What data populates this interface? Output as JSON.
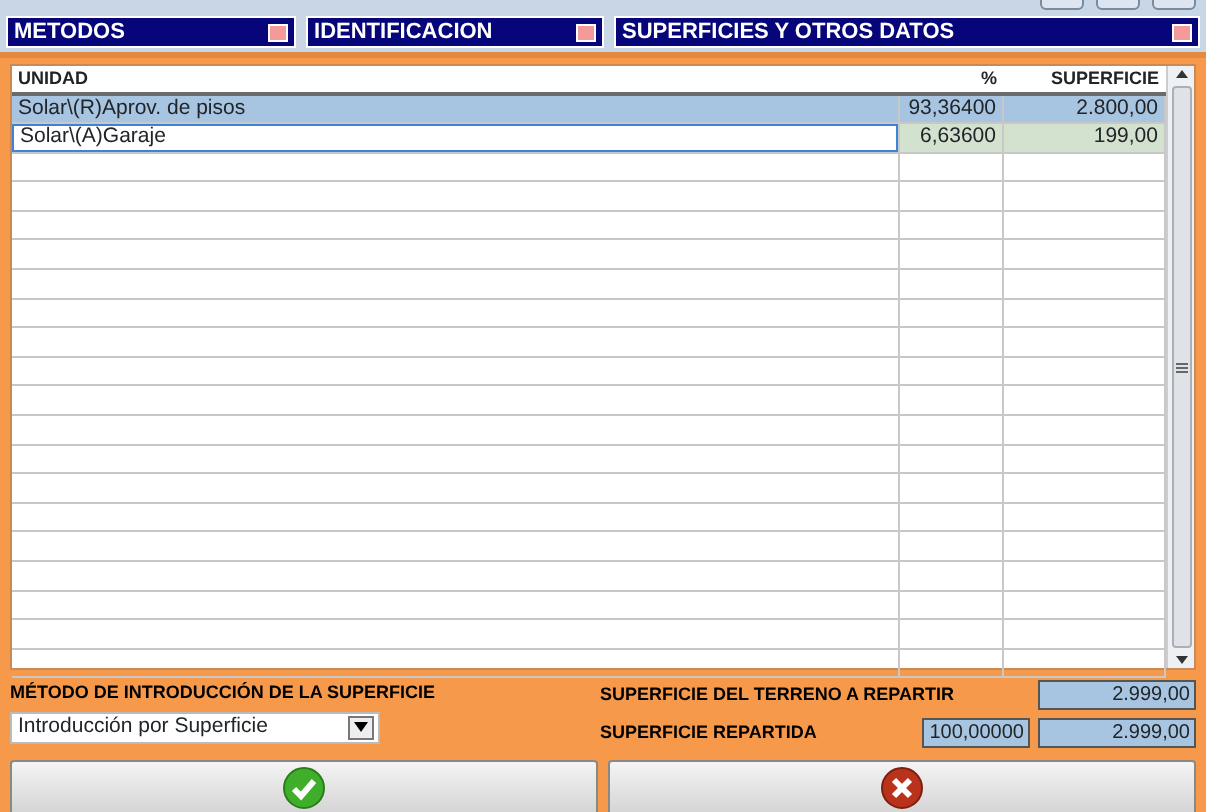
{
  "sections": [
    {
      "title": "METODOS"
    },
    {
      "title": "IDENTIFICACION"
    },
    {
      "title": "SUPERFICIES Y OTROS DATOS"
    }
  ],
  "table": {
    "columns": [
      "UNIDAD",
      "%",
      "SUPERFICIE"
    ],
    "rows": [
      {
        "cells": [
          "Solar\\(R)Aprov. de pisos",
          "93,36400",
          "2.800,00"
        ],
        "selected": true,
        "focused": false
      },
      {
        "cells": [
          "Solar\\(A)Garaje",
          "6,63600",
          "199,00"
        ],
        "selected": false,
        "focused": true
      }
    ]
  },
  "method": {
    "label": "MÉTODO DE INTRODUCCIÓN DE LA SUPERFICIE",
    "value": "Introducción por Superficie"
  },
  "totals": [
    {
      "label": "SUPERFICIE DEL TERRENO A REPARTIR",
      "values": [
        "2.999,00"
      ]
    },
    {
      "label": "SUPERFICIE REPARTIDA",
      "values": [
        "100,00000",
        "2.999,00"
      ]
    }
  ],
  "buttons": [
    {
      "kind": "accept"
    },
    {
      "kind": "cancel"
    }
  ]
}
